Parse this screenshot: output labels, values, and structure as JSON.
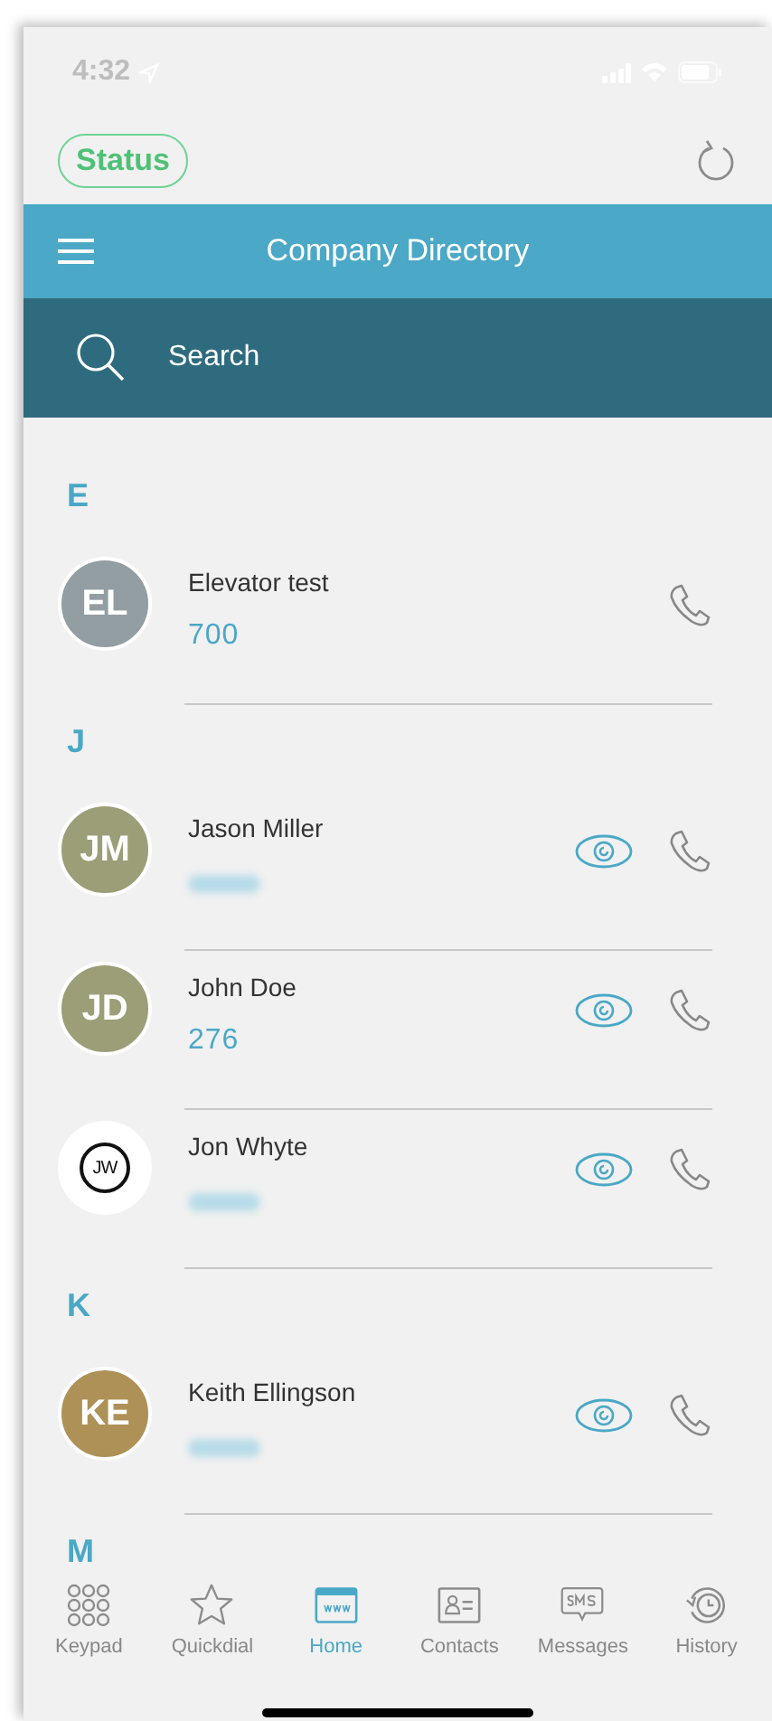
{
  "status_bar": {
    "time": "4:32"
  },
  "status_button": {
    "label": "Status"
  },
  "header": {
    "title": "Company Directory"
  },
  "search": {
    "placeholder": "Search"
  },
  "sections": [
    {
      "letter": "E",
      "contacts": [
        {
          "name": "Elevator test",
          "initials": "EL",
          "kind": "initials",
          "color": "#939ea2",
          "number": "700",
          "redacted": false,
          "watch": false
        }
      ]
    },
    {
      "letter": "J",
      "contacts": [
        {
          "name": "Jason Miller",
          "initials": "JM",
          "kind": "initials",
          "color": "#9c9e78",
          "redacted": true,
          "watch": true
        },
        {
          "name": "John Doe",
          "initials": "JD",
          "kind": "initials",
          "color": "#9c9e78",
          "number": "276",
          "redacted": false,
          "watch": true
        },
        {
          "name": "Jon Whyte",
          "initials": "JW",
          "kind": "logo",
          "redacted": true,
          "watch": true
        }
      ]
    },
    {
      "letter": "K",
      "contacts": [
        {
          "name": "Keith Ellingson",
          "initials": "KE",
          "kind": "initials",
          "color": "#ae9157",
          "redacted": true,
          "watch": true
        }
      ]
    },
    {
      "letter": "M"
    }
  ],
  "tabs": [
    {
      "label": "Keypad",
      "selected": false
    },
    {
      "label": "Quickdial",
      "selected": false
    },
    {
      "label": "Home",
      "selected": true
    },
    {
      "label": "Contacts",
      "selected": false
    },
    {
      "label": "Messages",
      "selected": false
    },
    {
      "label": "History",
      "selected": false
    }
  ]
}
